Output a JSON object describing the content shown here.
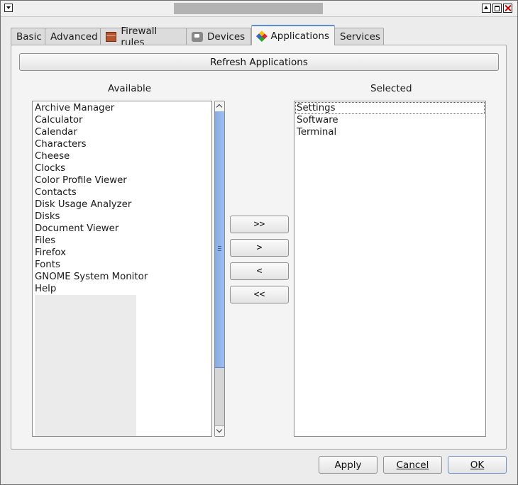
{
  "window": {
    "title": ""
  },
  "tabs": [
    {
      "label": "Basic",
      "icon": ""
    },
    {
      "label": "Advanced",
      "icon": ""
    },
    {
      "label": "Firewall rules",
      "icon": "firewall-icon"
    },
    {
      "label": "Devices",
      "icon": "devices-icon"
    },
    {
      "label": "Applications",
      "icon": "applications-icon",
      "active": true
    },
    {
      "label": "Services",
      "icon": ""
    }
  ],
  "applications": {
    "refresh_label": "Refresh Applications",
    "available_label": "Available",
    "selected_label": "Selected",
    "available_items": [
      "Archive Manager",
      "Calculator",
      "Calendar",
      "Characters",
      "Cheese",
      "Clocks",
      "Color Profile Viewer",
      "Contacts",
      "Disk Usage Analyzer",
      "Disks",
      "Document Viewer",
      "Files",
      "Firefox",
      "Fonts",
      "GNOME System Monitor",
      "Help"
    ],
    "selected_items": [
      "Settings",
      "Software",
      "Terminal"
    ],
    "move_all_right": ">>",
    "move_right": ">",
    "move_left": "<",
    "move_all_left": "<<"
  },
  "footer": {
    "apply_label": "Apply",
    "cancel_label": "Cancel",
    "ok_label": "OK"
  }
}
